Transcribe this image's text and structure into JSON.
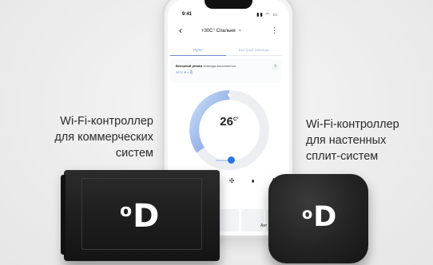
{
  "phone": {
    "time": "9:41",
    "status_icons": "▮▮ ◠ ▭",
    "back_icon": "‹",
    "room_title": "+30С° Спальня",
    "room_caret": "▾",
    "menu_icon": "⋮",
    "tabs": [
      "Пульт",
      "Быстрые команды"
    ],
    "mode_title": "Вечерний режим",
    "mode_subtitle": "команда выполняется",
    "mode_temp": "26°C ❄ ≈ ⎘",
    "help_icon": "?",
    "temperature": "26",
    "temperature_unit": "C°",
    "mode_icons": [
      "✣",
      "⬧",
      "A"
    ],
    "auto_label": "Авт"
  },
  "captions": {
    "left": [
      "Wi-Fi-контроллер",
      "для коммерческих",
      "систем"
    ],
    "right": [
      "Wi-Fi-контроллер",
      "для настенных",
      "сплит-систем"
    ]
  },
  "devices": {
    "commercial_logo_dot": "o",
    "commercial_logo_letter": "D",
    "split_logo_dot": "o",
    "split_logo_letter": "D"
  },
  "colors": {
    "accent": "#2b73e8",
    "dial_gradient": "#8fb2e9",
    "device_body": "#1e1e1e"
  }
}
